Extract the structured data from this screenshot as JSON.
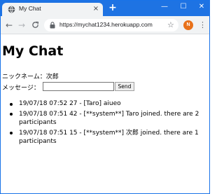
{
  "browser": {
    "tab_title": "My Chat",
    "tab_close_glyph": "×",
    "new_tab_glyph": "+",
    "window_controls": {
      "minimize": "—",
      "maximize": "☐",
      "close": "✕"
    },
    "nav": {
      "back": "←",
      "forward": "→",
      "reload": "C"
    },
    "url": "https://mychat1234.herokuapp.com",
    "star_glyph": "☆",
    "profile_initial": "N",
    "menu_glyph": "⋮",
    "icons": {
      "favicon": "globe-icon",
      "lock": "lock-icon",
      "star": "bookmark-star-icon",
      "profile": "profile-avatar-icon",
      "menu": "kebab-menu-icon"
    },
    "colors": {
      "titlebar": "#1e73e3",
      "toolbar": "#f1f3f4",
      "profile": "#e8711a"
    }
  },
  "page": {
    "title": "My Chat",
    "nickname_text": "ニックネーム：次郎",
    "message_label": "メッセージ：",
    "message_value": "",
    "send_label": "Send",
    "messages": [
      "19/07/18 07:52 27 - [Taro] aiueo",
      "19/07/18 07:51 42 - [**system**] Taro joined. there are 2 participants",
      "19/07/18 07:51 15 - [**system**] 次郎 joined. there are 1 participants"
    ]
  }
}
